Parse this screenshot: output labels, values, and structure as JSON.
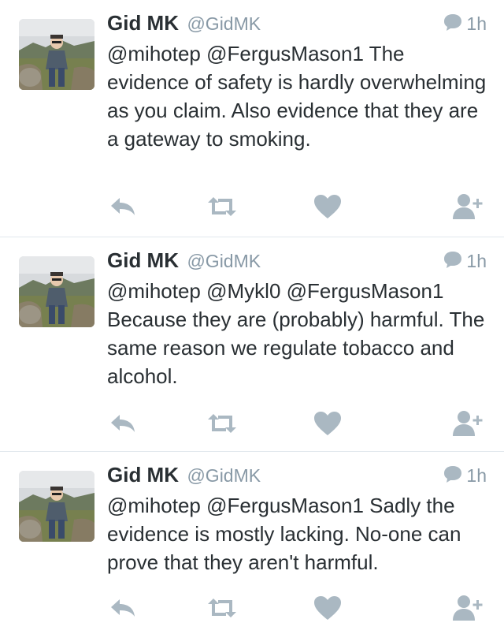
{
  "colors": {
    "icon": "#aab8c2",
    "name": "#292f33",
    "muted": "#8899a6",
    "divider": "#e1e8ed"
  },
  "icons": [
    "reply-icon",
    "retweet-icon",
    "like-icon",
    "follow-icon",
    "reply-bubble-icon"
  ],
  "tweets": [
    {
      "name": "Gid MK",
      "handle": "@GidMK",
      "time": "1h",
      "text": "@mihotep @FergusMason1 The evidence of safety is hardly overwhelming as you claim. Also evidence that they are a gateway to smoking."
    },
    {
      "name": "Gid MK",
      "handle": "@GidMK",
      "time": "1h",
      "text": "@mihotep @Mykl0 @FergusMason1 Because they are (probably) harmful. The same reason we regulate tobacco and alcohol."
    },
    {
      "name": "Gid MK",
      "handle": "@GidMK",
      "time": "1h",
      "text": "@mihotep @FergusMason1 Sadly the evidence is mostly lacking. No-one can prove that they aren't harmful."
    }
  ]
}
